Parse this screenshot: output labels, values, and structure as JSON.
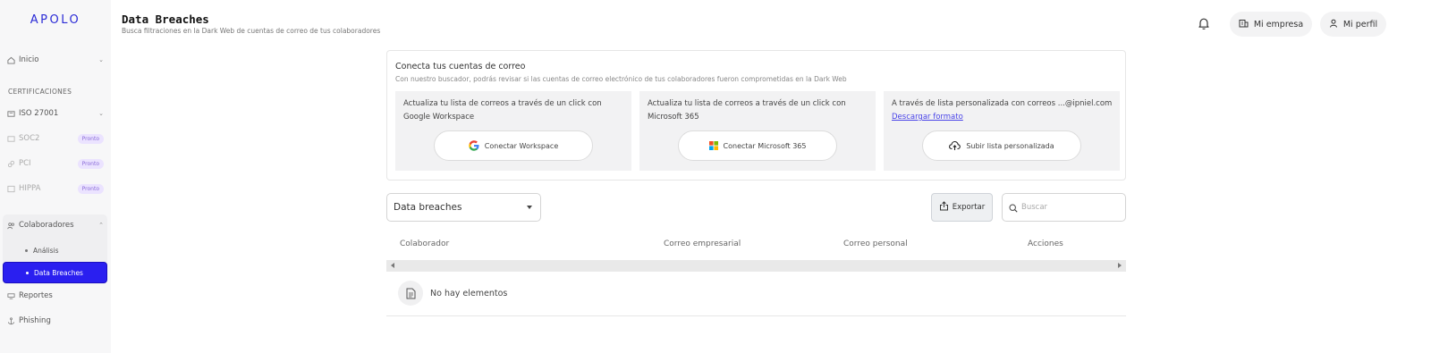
{
  "app": {
    "logo": "APOLO"
  },
  "sidebar": {
    "inicio": "Inicio",
    "section_certificaciones": "CERTIFICACIONES",
    "iso": "ISO 27001",
    "soc2": "SOC2",
    "pci": "PCI",
    "hippa": "HIPPA",
    "badge_pronto": "Pronto",
    "colaboradores": "Colaboradores",
    "analisis": "Análisis",
    "data_breaches": "Data Breaches",
    "reportes": "Reportes",
    "phishing": "Phishing"
  },
  "header": {
    "title": "Data Breaches",
    "subtitle": "Busca filtraciones en la Dark Web de cuentas de correo de tus colaboradores",
    "mi_empresa": "Mi empresa",
    "mi_perfil": "Mi perfil"
  },
  "connect": {
    "title": "Conecta tus cuentas de correo",
    "subtitle": "Con nuestro buscador, podrás revisar si las cuentas de correo electrónico de tus colaboradores fueron comprometidas en la Dark Web",
    "google_text": "Actualiza tu lista de correos a través de un click con Google Workspace",
    "google_button": "Conectar Workspace",
    "ms_text": "Actualiza tu lista de correos a través de un click con Microsoft 365",
    "ms_button": "Conectar Microsoft 365",
    "custom_text": "A través de lista personalizada con correos ...@ipniel.com",
    "custom_link": "Descargar formato",
    "custom_button": "Subir lista personalizada"
  },
  "toolbar": {
    "select_value": "Data breaches",
    "export": "Exportar",
    "search_placeholder": "Buscar"
  },
  "table": {
    "columns": [
      "Colaborador",
      "Correo empresarial",
      "Correo personal",
      "Acciones"
    ],
    "empty": "No hay elementos"
  },
  "colors": {
    "accent": "#2a1ff0",
    "link": "#4a44e8"
  }
}
